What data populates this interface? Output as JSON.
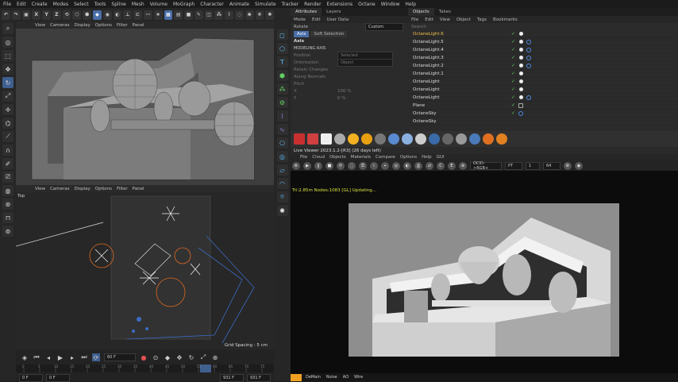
{
  "menu": [
    "File",
    "Edit",
    "Create",
    "Modes",
    "Select",
    "Tools",
    "Spline",
    "Mesh",
    "Volume",
    "MoGraph",
    "Character",
    "Animate",
    "Simulate",
    "Tracker",
    "Render",
    "Extensions",
    "Octane",
    "Window",
    "Help"
  ],
  "toolbar": {
    "x": "X",
    "y": "Y",
    "z": "Z"
  },
  "viewport_top": {
    "menu": [
      "View",
      "Cameras",
      "Display",
      "Options",
      "Filter",
      "Panel"
    ]
  },
  "viewport_bottom": {
    "menu": [
      "View",
      "Cameras",
      "Display",
      "Options",
      "Filter",
      "Panel"
    ],
    "label": "Top",
    "grid_spacing": "Grid Spacing : 5 cm"
  },
  "timeline": {
    "frame_field": "60 F",
    "start": "0 F",
    "current": "0 F",
    "end": "931 F",
    "end2": "931 F",
    "ruler": [
      "0",
      "5",
      "10",
      "15",
      "20",
      "25",
      "30",
      "35",
      "40",
      "45",
      "50",
      "55",
      "60",
      "65",
      "70",
      "75"
    ]
  },
  "attributes": {
    "tabs": [
      "Attributes",
      "Layers"
    ],
    "menu": [
      "Mode",
      "Edit",
      "User Data"
    ],
    "tool": "Rotate",
    "preset": "Custom",
    "subtabs": [
      "Axis",
      "Soft Selection"
    ],
    "section": "Axis",
    "subsection": "MODELING AXIS",
    "rows": [
      {
        "label": "Position",
        "value": "Selected"
      },
      {
        "label": "Orientation",
        "value": "Object"
      },
      {
        "label": "Retain Changes",
        "value": ""
      },
      {
        "label": "Along Normals",
        "value": ""
      },
      {
        "label": "Pitch",
        "value": ""
      },
      {
        "label": "X",
        "value": "100 %"
      },
      {
        "label": "Y",
        "value": "0 %"
      }
    ]
  },
  "objects": {
    "tabs": [
      "Objects",
      "Takes"
    ],
    "menu": [
      "File",
      "Edit",
      "View",
      "Object",
      "Tags",
      "Bookmarks"
    ],
    "search": "Search",
    "items": [
      {
        "name": "OctaneLight.6",
        "selected": true
      },
      {
        "name": "OctaneLight.5",
        "selected": false
      },
      {
        "name": "OctaneLight.4",
        "selected": false
      },
      {
        "name": "OctaneLight.3",
        "selected": false
      },
      {
        "name": "OctaneLight.2",
        "selected": false
      },
      {
        "name": "OctaneLight.1",
        "selected": false
      },
      {
        "name": "OctaneLight",
        "selected": false
      },
      {
        "name": "OctaneLight",
        "selected": false
      },
      {
        "name": "OctaneLight",
        "selected": false
      },
      {
        "name": "Plane",
        "selected": false
      },
      {
        "name": "OctaneSky",
        "selected": false
      },
      {
        "name": "OctaneSky",
        "selected": false
      }
    ]
  },
  "live_viewer": {
    "title": "Live Viewer 2023.1.2-[R3] (26 days left)",
    "menu": [
      "File",
      "Cloud",
      "Objects",
      "Materials",
      "Compare",
      "Options",
      "Help",
      "GUI"
    ],
    "tonemap": "OCIO->RGB+",
    "pt": "PT",
    "count": "1",
    "samples": "64",
    "status": "Tri:2.85m  Nodes:1083   [GL] Updating...",
    "bottom": [
      "DeMain",
      "Noise",
      "AO",
      "Wire"
    ]
  },
  "colors": {
    "accent": "#4a6ea8",
    "selected": "#f0c24a",
    "status": "#d8e040",
    "check": "#5fcf5f"
  }
}
